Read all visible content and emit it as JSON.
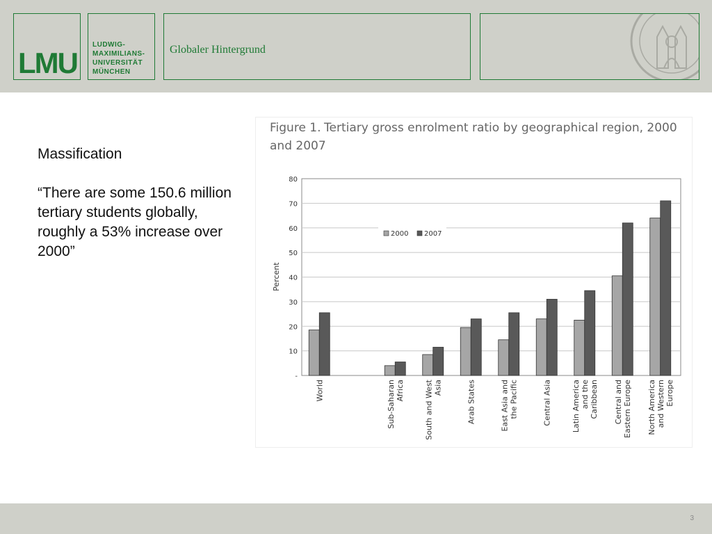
{
  "header": {
    "logo_text": "LMU",
    "university_lines": [
      "LUDWIG-",
      "MAXIMILIANS-",
      "UNIVERSITÄT",
      "MÜNCHEN"
    ],
    "section_title": "Globaler Hintergrund",
    "brand_color": "#1f7a35",
    "background_color": "#cfd0c9"
  },
  "body": {
    "heading": "Massification",
    "quote": "“There are some 150.6 million tertiary students globally, roughly a 53% increase over 2000”"
  },
  "figure": {
    "caption_label": "Figure 1.",
    "caption_text": "Tertiary gross enrolment ratio by geographical region, 2000 and 2007"
  },
  "chart_data": {
    "type": "bar",
    "title": "Figure 1. Tertiary gross enrolment ratio by geographical region, 2000 and 2007",
    "ylabel": "Percent",
    "xlabel": "",
    "ylim": [
      0,
      80
    ],
    "yticks": [
      "-",
      "10",
      "20",
      "30",
      "40",
      "50",
      "60",
      "70",
      "80"
    ],
    "grid": true,
    "legend_position": "top-left",
    "categories": [
      [
        "World"
      ],
      [],
      [
        "Sub-Saharan",
        "Africa"
      ],
      [
        "South and West",
        "Asia"
      ],
      [
        "Arab States"
      ],
      [
        "East Asia and",
        "the Pacific"
      ],
      [
        "Central Asia"
      ],
      [
        "Latin America",
        "and the",
        "Caribbean"
      ],
      [
        "Central and",
        "Eastern Europe"
      ],
      [
        "North America",
        "and Western",
        "Europe"
      ]
    ],
    "series": [
      {
        "name": "2000",
        "color": "#a6a6a6",
        "values": [
          18.5,
          null,
          4,
          8.5,
          19.5,
          14.5,
          23,
          22.5,
          40.5,
          64
        ]
      },
      {
        "name": "2007",
        "color": "#595959",
        "values": [
          25.5,
          null,
          5.5,
          11.5,
          23,
          25.5,
          31,
          34.5,
          62,
          71
        ]
      }
    ]
  },
  "footer": {
    "page_number": "3"
  }
}
